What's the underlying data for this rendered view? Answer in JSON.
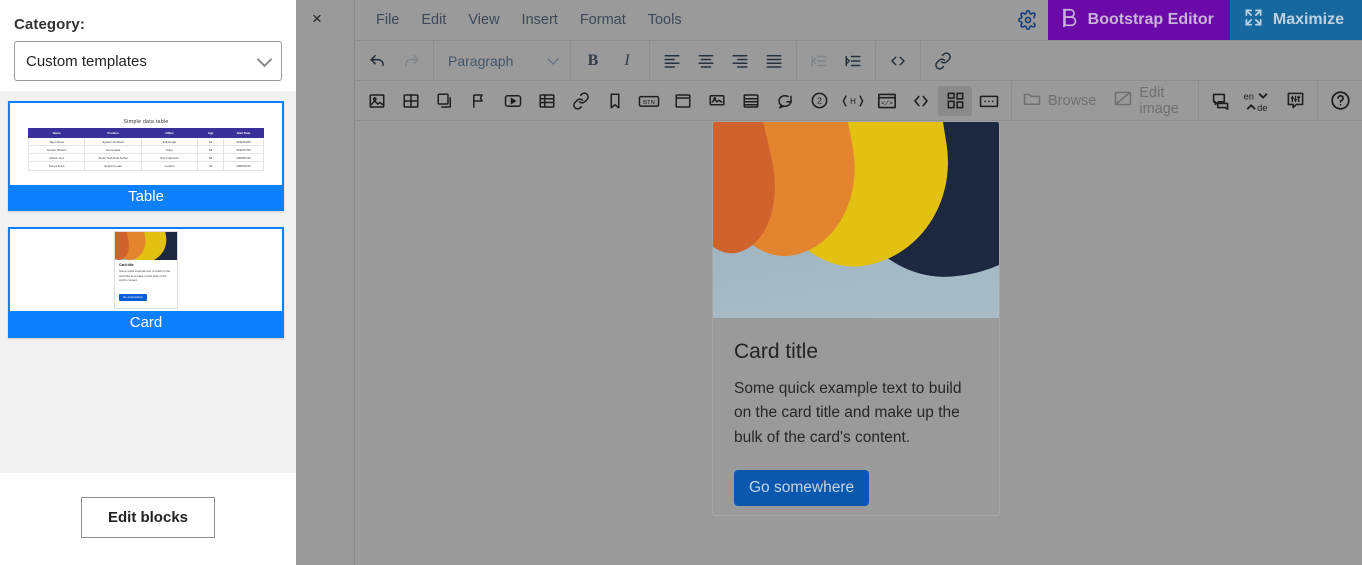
{
  "dialog": {
    "category_label": "Category:",
    "category_value": "Custom templates",
    "caret_icon": "chevron-down-icon",
    "close_icon": "×",
    "edit_blocks_label": "Edit blocks",
    "templates": [
      {
        "caption": "Table",
        "preview_type": "table",
        "preview_title": "Simple data table",
        "columns": [
          "Name",
          "Position",
          "Office",
          "Age",
          "Start Date"
        ],
        "rows": [
          [
            "Tiger Nixon",
            "System Architect",
            "Edinburgh",
            "61",
            "2011/04/25"
          ],
          [
            "Garrett Winters",
            "Accountant",
            "Tokyo",
            "63",
            "2011/07/25"
          ],
          [
            "Ashton Cox",
            "Junior Technical Author",
            "San Francisco",
            "66",
            "2009/01/12"
          ],
          [
            "Sonya Frost",
            "Support Lead",
            "London",
            "34",
            "2008/12/13"
          ]
        ]
      },
      {
        "caption": "Card",
        "preview_type": "card",
        "card_title": "Card title",
        "card_text": "Some quick example text to build on the card title and make up the bulk of the card's content.",
        "card_button": "Go somewhere"
      }
    ]
  },
  "editor": {
    "menu": [
      "File",
      "Edit",
      "View",
      "Insert",
      "Format",
      "Tools"
    ],
    "gear_icon": "gear-icon",
    "brand_button": {
      "label": "Bootstrap Editor",
      "icon": "bootstrap-b-icon",
      "color": "#6b0aa8"
    },
    "maximize_button": {
      "label": "Maximize",
      "icon": "expand-arrows-icon",
      "color": "#17689e"
    },
    "toolbar_row1": [
      {
        "name": "undo-icon",
        "label": "Undo",
        "disabled": false
      },
      {
        "name": "redo-icon",
        "label": "Redo",
        "disabled": true
      },
      {
        "name": "format-select",
        "label": "Paragraph",
        "disabled": false
      },
      {
        "name": "bold-icon",
        "label": "Bold",
        "disabled": false
      },
      {
        "name": "italic-icon",
        "label": "Italic",
        "disabled": false
      },
      {
        "name": "align-left-icon",
        "label": "Align left",
        "disabled": false
      },
      {
        "name": "align-center-icon",
        "label": "Align center",
        "disabled": false
      },
      {
        "name": "align-right-icon",
        "label": "Align right",
        "disabled": false
      },
      {
        "name": "align-justify-icon",
        "label": "Justify",
        "disabled": false
      },
      {
        "name": "outdent-icon",
        "label": "Decrease indent",
        "disabled": true
      },
      {
        "name": "indent-icon",
        "label": "Increase indent",
        "disabled": false
      },
      {
        "name": "source-code-icon",
        "label": "Source code",
        "disabled": false
      },
      {
        "name": "link-icon",
        "label": "Insert link",
        "disabled": false
      }
    ],
    "toolbar_row2": [
      {
        "name": "image-icon",
        "label": "Insert image"
      },
      {
        "name": "image-grid-icon",
        "label": "Image gallery"
      },
      {
        "name": "layers-icon",
        "label": "Layers"
      },
      {
        "name": "flag-icon",
        "label": "Flag"
      },
      {
        "name": "video-icon",
        "label": "Insert video"
      },
      {
        "name": "table-icon",
        "label": "Insert table"
      },
      {
        "name": "link2-icon",
        "label": "Link"
      },
      {
        "name": "bookmark-icon",
        "label": "Bookmark"
      },
      {
        "name": "button-icon",
        "label": "Button"
      },
      {
        "name": "window-icon",
        "label": "Window"
      },
      {
        "name": "carousel-icon",
        "label": "Carousel"
      },
      {
        "name": "accordion-icon",
        "label": "Accordion"
      },
      {
        "name": "comment-icon",
        "label": "Comment"
      },
      {
        "name": "circle-two-icon",
        "label": "Columns"
      },
      {
        "name": "heading-icon",
        "label": "Heading"
      },
      {
        "name": "code-window-icon",
        "label": "Code window"
      },
      {
        "name": "code-tags-icon",
        "label": "Code"
      },
      {
        "name": "blocks-icon",
        "label": "Blocks",
        "active": true
      },
      {
        "name": "ellipsis-box-icon",
        "label": "More"
      }
    ],
    "browse_label": "Browse",
    "edit_image_label": "Edit image",
    "lang_from": "en",
    "lang_to": "de",
    "help_icon": "help-circle-icon"
  },
  "content": {
    "card_title": "Card title",
    "card_text": "Some quick example text to build on the card title and make up the bulk of the card's content.",
    "card_button": "Go somewhere",
    "image_alt": "folded-paper-sheets-image"
  },
  "colors": {
    "accent_blue": "#0d80ff",
    "brand_purple": "#6b0aa8",
    "maximize_blue": "#17689e",
    "card_button_blue": "#0a58ad",
    "table_header_purple": "#3b2f99"
  }
}
